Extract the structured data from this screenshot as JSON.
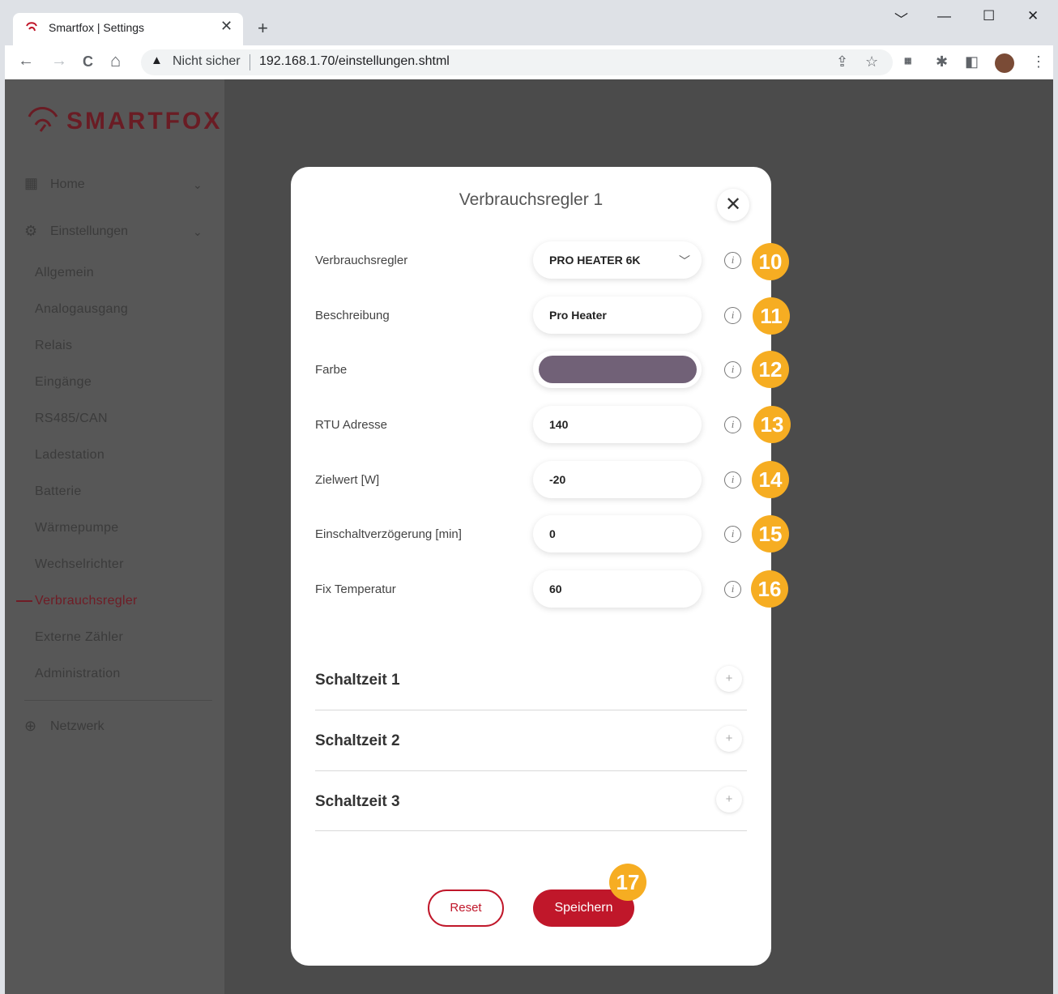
{
  "browser": {
    "tab_title": "Smartfox | Settings",
    "tab_close": "✕",
    "new_tab": "+",
    "window_buttons": [
      "﹀",
      "—",
      "☐",
      "✕"
    ],
    "nav": {
      "back": "←",
      "forward": "→",
      "reload": "C",
      "home": "⌂"
    },
    "security_icon": "▲",
    "security_text": "Nicht sicher",
    "url": "192.168.1.70/einstellungen.shtml",
    "toolbar_icons": [
      "share-icon",
      "star-icon",
      "new-extension-icon",
      "puzzle-icon",
      "sidepanel-icon",
      "profile-avatar",
      "menu-icon"
    ]
  },
  "brand": {
    "logo_text": "SMARTFOX",
    "accent": "#c0172a",
    "dark_accent": "#6f1c25"
  },
  "sidebar": {
    "home": "Home",
    "settings": "Einstellungen",
    "items": [
      "Allgemein",
      "Analogausgang",
      "Relais",
      "Eingänge",
      "RS485/CAN",
      "Ladestation",
      "Batterie",
      "Wärmepumpe",
      "Wechselrichter",
      "Verbrauchsregler",
      "Externe Zähler",
      "Administration"
    ],
    "active_item": "Verbrauchsregler",
    "network": "Netzwerk"
  },
  "modal": {
    "title": "Verbrauchsregler 1",
    "fields": [
      {
        "label": "Verbrauchsregler",
        "value": "PRO HEATER 6K",
        "badge": "10"
      },
      {
        "label": "Beschreibung",
        "value": "Pro Heater",
        "badge": "11"
      },
      {
        "label": "Farbe",
        "value": "",
        "badge": "12"
      },
      {
        "label": "RTU Adresse",
        "value": "140",
        "badge": "13"
      },
      {
        "label": "Zielwert [W]",
        "value": "-20",
        "badge": "14"
      },
      {
        "label": "Einschaltverzögerung [min]",
        "value": "0",
        "badge": "15"
      },
      {
        "label": "Fix Temperatur",
        "value": "60",
        "badge": "16"
      }
    ],
    "color_value": "#716177",
    "info_glyph": "i",
    "schaltzeiten": [
      "Schaltzeit 1",
      "Schaltzeit 2",
      "Schaltzeit 3"
    ],
    "plus_glyph": "+",
    "reset": "Reset",
    "save": "Speichern",
    "save_badge": "17"
  }
}
